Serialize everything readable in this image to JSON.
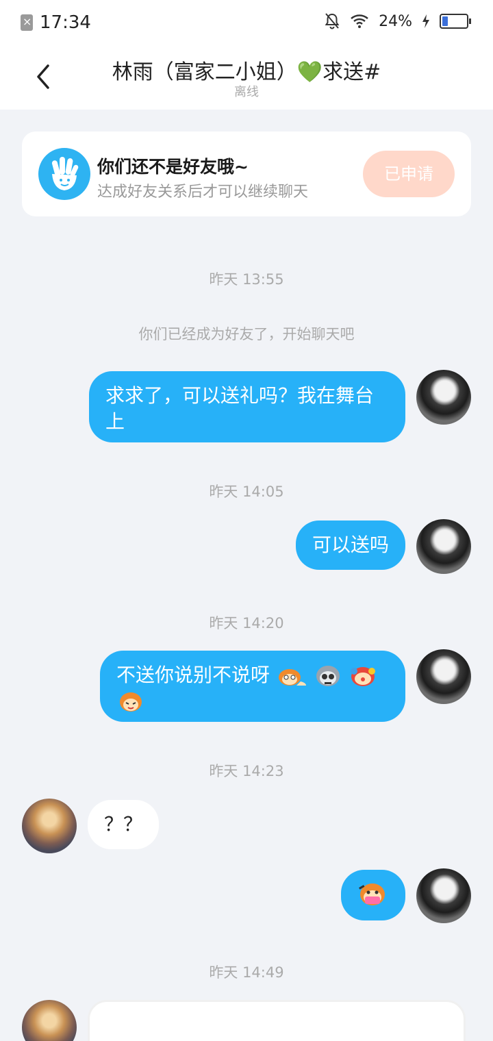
{
  "status_bar": {
    "time": "17:34",
    "battery_percent": "24%",
    "battery_level": 0.24,
    "icons": [
      "sim-off-icon",
      "bell-off-icon",
      "wifi-icon",
      "charging-icon",
      "battery-icon"
    ]
  },
  "header": {
    "title": "林雨（富家二小姐）💚求送#",
    "status": "离线",
    "back_icon": "chevron-left-icon"
  },
  "friend_card": {
    "title": "你们还不是好友哦~",
    "subtitle": "达成好友关系后才可以继续聊天",
    "button_label": "已申请",
    "icon": "hand-wave-icon",
    "colors": {
      "icon_bg": "#2eb3f2",
      "button_bg": "#ffd8ca"
    }
  },
  "messages": {
    "ts1": "昨天 13:55",
    "system": "你们已经成为好友了，开始聊天吧",
    "m1": "求求了，可以送礼吗？我在舞台上",
    "ts2": "昨天 14:05",
    "m2": "可以送吗",
    "ts3": "昨天 14:20",
    "m3": "不送你说别不说呀",
    "m3_emojis": [
      "lying-monkey-emoji",
      "skull-emoji",
      "clown-emoji",
      "monkey-emoji"
    ],
    "ts4": "昨天 14:23",
    "m4": "？？",
    "m5_emoji": "mask-monkey-emoji",
    "ts5": "昨天 14:49"
  },
  "colors": {
    "out_bubble": "#27b1f8",
    "in_bubble": "#ffffff",
    "background": "#f1f3f7"
  }
}
